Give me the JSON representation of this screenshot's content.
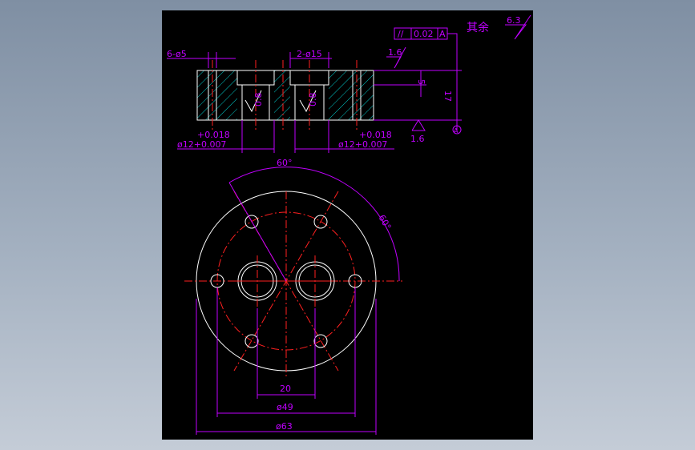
{
  "colors": {
    "background": "#000000",
    "dimension": "#c000ff",
    "outline": "#ffffff",
    "centerline": "#ff2020",
    "hatch": "#00c8c8"
  },
  "side_view": {
    "holes_callout": "6-ø5",
    "bore_callout": "2-ø15",
    "flatness_box": [
      "//",
      "0.02",
      "A"
    ],
    "roughness_top": "1.6",
    "roughness_bottom": "1.6",
    "roughness_bore_left": "0.8",
    "roughness_bore_right": "0.8",
    "dim_depth": "5",
    "dim_height": "17",
    "datum": "A",
    "tol_left_upper": "+0.018",
    "tol_left_lower": "ø12+0.007",
    "tol_right_upper": "+0.018",
    "tol_right_lower": "ø12+0.007"
  },
  "remaining": {
    "text": "其余",
    "roughness": "6.3"
  },
  "top_view": {
    "angle_top": "60°",
    "angle_right": "60°",
    "dim_center": "20",
    "dim_pcd": "ø49",
    "dim_outer": "ø63"
  }
}
